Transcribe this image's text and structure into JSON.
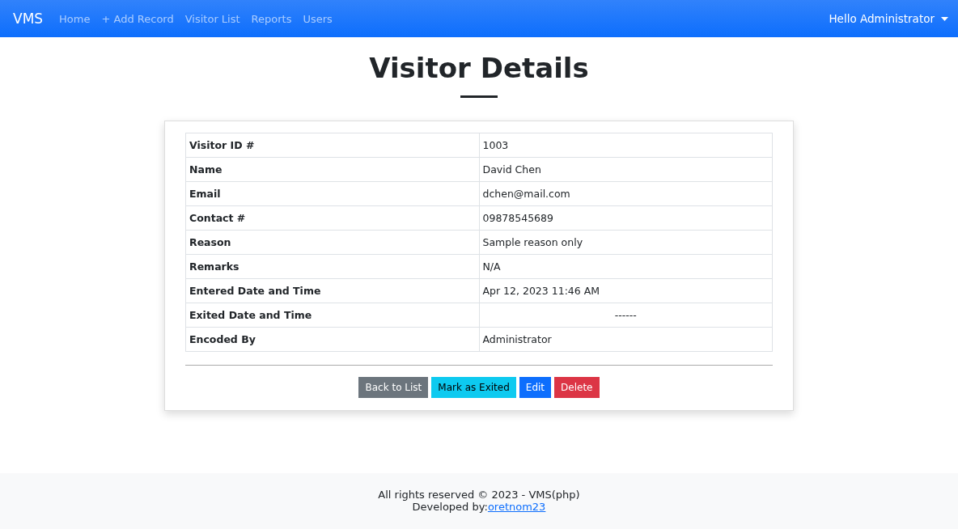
{
  "navbar": {
    "brand": "VMS",
    "links": [
      "Home",
      "+ Add Record",
      "Visitor List",
      "Reports",
      "Users"
    ],
    "user_menu": "Hello Administrator"
  },
  "page_title": "Visitor Details",
  "details": [
    {
      "label": "Visitor ID #",
      "value": "1003",
      "centered": false
    },
    {
      "label": "Name",
      "value": "David Chen",
      "centered": false
    },
    {
      "label": "Email",
      "value": "dchen@mail.com",
      "centered": false
    },
    {
      "label": "Contact #",
      "value": "09878545689",
      "centered": false
    },
    {
      "label": "Reason",
      "value": "Sample reason only",
      "centered": false
    },
    {
      "label": "Remarks",
      "value": "N/A",
      "centered": false
    },
    {
      "label": "Entered Date and Time",
      "value": "Apr 12, 2023 11:46 AM",
      "centered": false
    },
    {
      "label": "Exited Date and Time",
      "value": "------",
      "centered": true
    },
    {
      "label": "Encoded By",
      "value": "Administrator",
      "centered": false
    }
  ],
  "buttons": [
    {
      "label": "Back to List",
      "kind": "secondary"
    },
    {
      "label": "Mark as Exited",
      "kind": "info"
    },
    {
      "label": "Edit",
      "kind": "primary"
    },
    {
      "label": "Delete",
      "kind": "danger"
    }
  ],
  "footer": {
    "copyright": "All rights reserved © 2023 - VMS(php)",
    "developed_by": "Developed by:",
    "author_link": "oretnom23"
  }
}
